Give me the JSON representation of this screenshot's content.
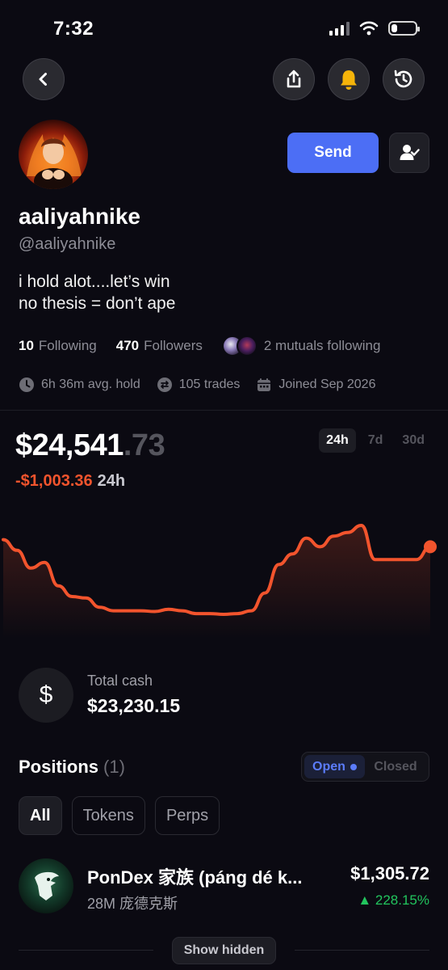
{
  "status_bar": {
    "time": "7:32"
  },
  "nav": {
    "back_icon": "chevron-left-icon",
    "share_icon": "share-icon",
    "bell_icon": "bell-icon",
    "history_icon": "history-icon",
    "bell_color": "#f5b40a"
  },
  "profile": {
    "display_name": "aaliyahnike",
    "handle": "@aaliyahnike",
    "bio_line1": "i hold alot....let’s win",
    "bio_line2": "no thesis = don’t ape",
    "send_label": "Send",
    "follow_icon": "user-check-icon",
    "following_count": "10",
    "following_label": "Following",
    "followers_count": "470",
    "followers_label": "Followers",
    "mutuals_label": "2 mutuals following",
    "avg_hold": "6h 36m avg. hold",
    "trades": "105 trades",
    "joined": "Joined Sep 2026"
  },
  "portfolio": {
    "value_dollars": "$24,541",
    "value_cents": ".73",
    "change_value": "-$1,003.36",
    "change_period": "24h",
    "ranges": [
      "24h",
      "7d",
      "30d"
    ],
    "active_range": "24h",
    "accent_color": "#f2542d"
  },
  "chart_data": {
    "type": "line",
    "title": "",
    "xlabel": "",
    "ylabel": "",
    "series": [
      {
        "values": [
          24620,
          24605,
          24580,
          24588,
          24555,
          24540,
          24538,
          24525,
          24520,
          24520,
          24520,
          24519,
          24522,
          24520,
          24516,
          24516,
          24515,
          24516,
          24520,
          24545,
          24585,
          24600,
          24622,
          24610,
          24625,
          24630,
          24640,
          24592,
          24592,
          24592,
          24592,
          24610
        ]
      }
    ],
    "grid": false,
    "legend": "none"
  },
  "cash": {
    "icon": "dollar-icon",
    "label": "Total cash",
    "value": "$23,230.15"
  },
  "positions": {
    "title": "Positions",
    "count": "(1)",
    "open_label": "Open",
    "closed_label": "Closed",
    "filters": [
      "All",
      "Tokens",
      "Perps"
    ],
    "active_filter": "All",
    "items": [
      {
        "name": "PonDex 家族 (páng dé k...",
        "sub": "28M 庞德克斯",
        "value": "$1,305.72",
        "change": "228.15%",
        "change_color": "#22c55e"
      }
    ],
    "show_hidden_label": "Show hidden"
  }
}
